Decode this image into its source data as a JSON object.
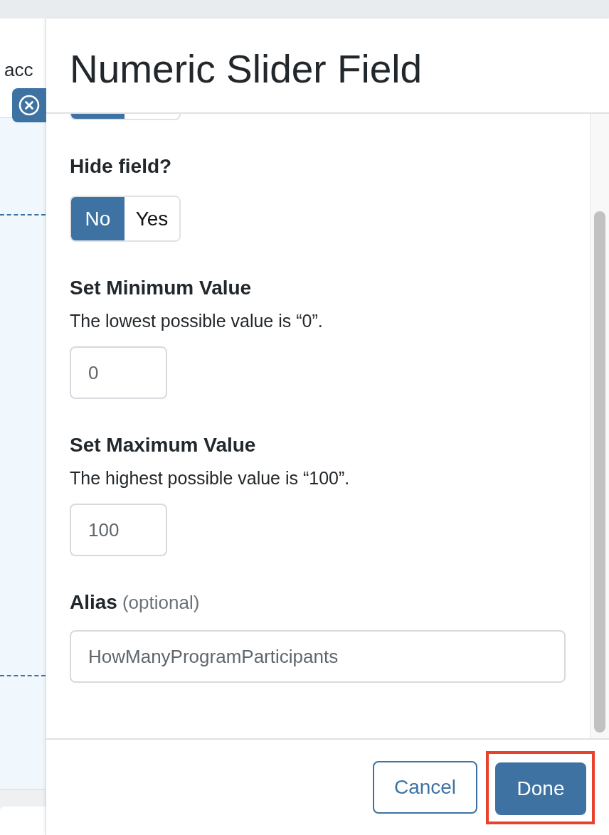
{
  "background": {
    "heading_fragment": "acc"
  },
  "panel": {
    "title": "Numeric Slider Field"
  },
  "fields": [
    {
      "kind": "toggle_stub",
      "options": [
        {
          "selected": true
        },
        {
          "selected": false
        }
      ]
    },
    {
      "kind": "toggle",
      "label": "Hide field?",
      "options": [
        {
          "label": "No",
          "selected": true
        },
        {
          "label": "Yes",
          "selected": false
        }
      ]
    },
    {
      "kind": "number",
      "label": "Set Minimum Value",
      "description": "The lowest possible value is “0”.",
      "value": "0"
    },
    {
      "kind": "number",
      "label": "Set Maximum Value",
      "description": "The highest possible value is “100”.",
      "value": "100"
    },
    {
      "kind": "text",
      "label": "Alias",
      "note": "(optional)",
      "value": "HowManyProgramParticipants"
    }
  ],
  "footer": {
    "buttons": [
      {
        "label": "Cancel",
        "kind": "secondary",
        "highlighted": false
      },
      {
        "label": "Done",
        "kind": "primary",
        "highlighted": true
      }
    ]
  }
}
